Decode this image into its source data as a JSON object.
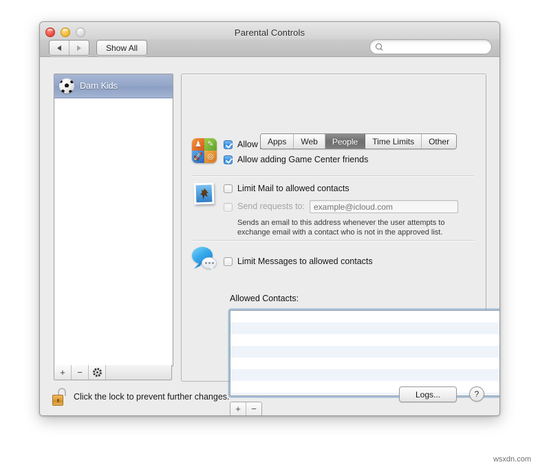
{
  "window": {
    "title": "Parental Controls",
    "traffic_lights": [
      "close",
      "minimize",
      "zoom"
    ],
    "toolbar": {
      "back_label": "◀",
      "forward_label": "▶",
      "show_all_label": "Show All",
      "search_placeholder": "",
      "search_value": ""
    }
  },
  "tabs": [
    {
      "label": "Apps",
      "active": false
    },
    {
      "label": "Web",
      "active": false
    },
    {
      "label": "People",
      "active": true
    },
    {
      "label": "Time Limits",
      "active": false
    },
    {
      "label": "Other",
      "active": false
    }
  ],
  "sidebar": {
    "accounts": [
      {
        "name": "Darn Kids",
        "selected": true
      }
    ],
    "toolbar": {
      "add_label": "+",
      "remove_label": "−",
      "gear_label": ""
    }
  },
  "people": {
    "game_center": {
      "checkboxes": [
        {
          "label": "Allow joining Game Center multiplayer games",
          "checked": true,
          "enabled": true
        },
        {
          "label": "Allow adding Game Center friends",
          "checked": true,
          "enabled": true
        }
      ]
    },
    "mail": {
      "limit_label": "Limit Mail to allowed contacts",
      "limit_checked": false,
      "send_requests_label": "Send requests to:",
      "send_requests_checked": false,
      "send_requests_enabled": false,
      "email_value": "",
      "email_placeholder": "example@icloud.com",
      "hint_line1": "Sends an email to this address whenever the user attempts to",
      "hint_line2": "exchange email with a contact who is not in the approved list."
    },
    "messages": {
      "limit_label": "Limit Messages to allowed contacts",
      "limit_checked": false
    },
    "allowed_contacts": {
      "label": "Allowed Contacts:",
      "items": [],
      "row_count": 8,
      "add_label": "+",
      "remove_label": "−"
    }
  },
  "footer": {
    "lock_text": "Click the lock to prevent further changes.",
    "lock_state": "unlocked",
    "logs_label": "Logs...",
    "help_label": "?"
  },
  "watermark": "wsxdn.com",
  "colors": {
    "accent_blue": "#3f96e8",
    "selection_blue": "#93a6c8",
    "list_stripe": "#eff4fb",
    "focus_ring": "#759fcc"
  }
}
